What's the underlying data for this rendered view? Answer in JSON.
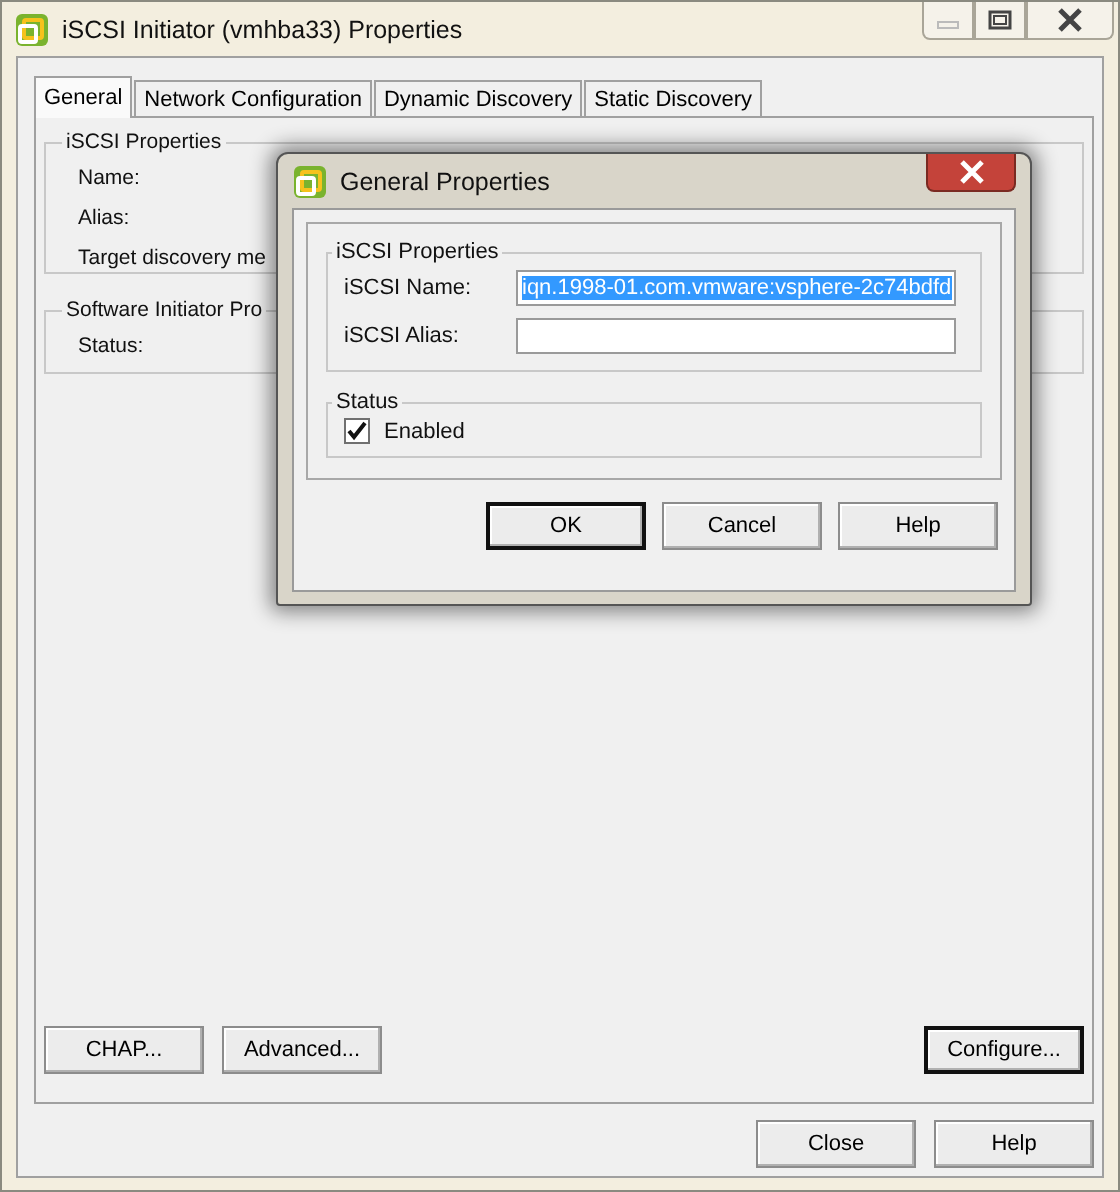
{
  "window": {
    "title": "iSCSI Initiator (vmhba33) Properties"
  },
  "tabs": [
    {
      "label": "General",
      "selected": true
    },
    {
      "label": "Network Configuration",
      "selected": false
    },
    {
      "label": "Dynamic Discovery",
      "selected": false
    },
    {
      "label": "Static Discovery",
      "selected": false
    }
  ],
  "iscsi_properties": {
    "title": "iSCSI Properties",
    "labels": [
      "Name:",
      "Alias:",
      "Target discovery me"
    ]
  },
  "software_initiator": {
    "title": "Software Initiator Pro",
    "labels": [
      "Status:"
    ]
  },
  "panel_buttons": [
    {
      "label": "CHAP...",
      "default": false
    },
    {
      "label": "Advanced...",
      "default": false
    },
    {
      "label": "Configure...",
      "default": true
    }
  ],
  "footer_buttons": [
    {
      "label": "Close",
      "default": false
    },
    {
      "label": "Help",
      "default": false
    }
  ],
  "dialog": {
    "title": "General Properties",
    "group": "iSCSI Properties",
    "fields": [
      {
        "label": "iSCSI Name:",
        "value": "iqn.1998-01.com.vmware:vsphere-2c74bdfd",
        "value_highlighted": true
      },
      {
        "label": "iSCSI Alias:"
      }
    ],
    "status": {
      "title": "Status",
      "checkbox": {
        "label": "Enabled",
        "checked": true
      }
    },
    "buttons": [
      {
        "label": "OK",
        "default": true
      },
      {
        "label": "Cancel",
        "default": false
      },
      {
        "label": "Help",
        "default": false
      }
    ]
  }
}
